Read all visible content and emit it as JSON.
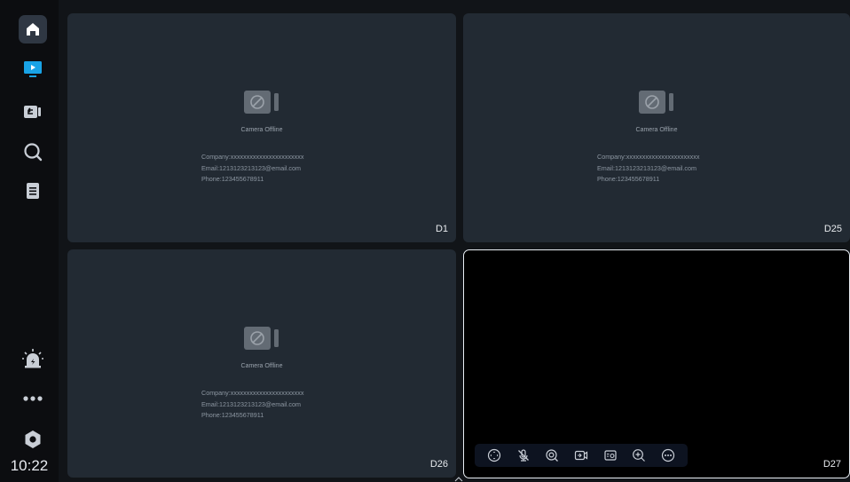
{
  "sidebar": {
    "clock": "10:22",
    "items": [
      {
        "name": "home-icon"
      },
      {
        "name": "live-view-icon"
      },
      {
        "name": "playback-icon"
      },
      {
        "name": "search-icon"
      },
      {
        "name": "log-icon"
      },
      {
        "name": "alarm-icon"
      },
      {
        "name": "more-icon"
      },
      {
        "name": "settings-icon"
      }
    ],
    "accent_color": "#19a3e6"
  },
  "tiles": [
    {
      "label": "D1",
      "status": "Camera Offline",
      "company": "Company:xxxxxxxxxxxxxxxxxxxxxxx",
      "email": "Email:1213123213123@email.com",
      "phone": "Phone:123455678911"
    },
    {
      "label": "D25",
      "status": "Camera Offline",
      "company": "Company:xxxxxxxxxxxxxxxxxxxxxxx",
      "email": "Email:1213123213123@email.com",
      "phone": "Phone:123455678911"
    },
    {
      "label": "D26",
      "status": "Camera Offline",
      "company": "Company:xxxxxxxxxxxxxxxxxxxxxxx",
      "email": "Email:1213123213123@email.com",
      "phone": "Phone:123455678911"
    },
    {
      "label": "D27",
      "selected": true,
      "toolbar": [
        "ptz-icon",
        "mute-icon",
        "focus-icon",
        "record-icon",
        "snapshot-icon",
        "zoom-in-icon",
        "more-options-icon"
      ]
    }
  ]
}
